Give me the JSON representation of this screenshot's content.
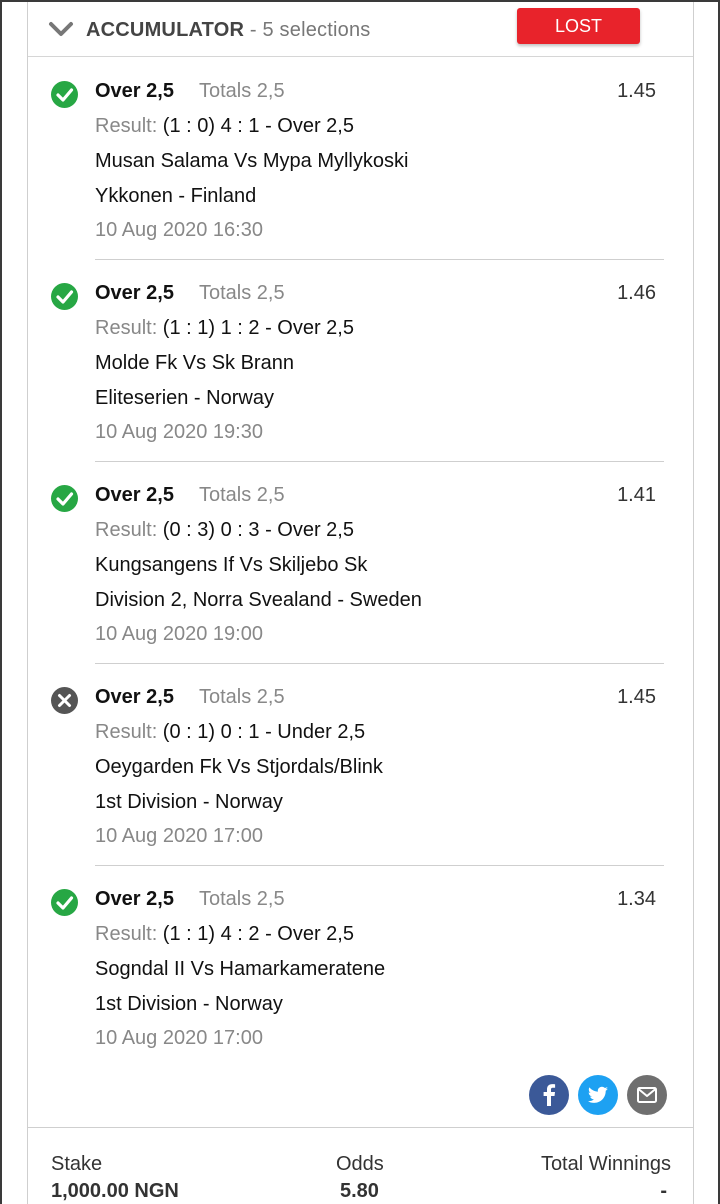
{
  "header": {
    "title": "ACCUMULATOR",
    "subtitle": " - 5 selections",
    "status": "LOST",
    "status_color": "#e8232b"
  },
  "selections": [
    {
      "status": "won",
      "pick": "Over 2,5",
      "market": "Totals 2,5",
      "odds": "1.45",
      "result_label": "Result:",
      "result": " (1 : 0) 4 : 1 - Over 2,5",
      "match": "Musan Salama Vs Mypa Myllykoski",
      "league": "Ykkonen - Finland",
      "date": "10 Aug 2020 16:30"
    },
    {
      "status": "won",
      "pick": "Over 2,5",
      "market": "Totals 2,5",
      "odds": "1.46",
      "result_label": "Result:",
      "result": " (1 : 1) 1 : 2 - Over 2,5",
      "match": "Molde Fk Vs Sk Brann",
      "league": "Eliteserien - Norway",
      "date": "10 Aug 2020 19:30"
    },
    {
      "status": "won",
      "pick": "Over 2,5",
      "market": "Totals 2,5",
      "odds": "1.41",
      "result_label": "Result:",
      "result": " (0 : 3) 0 : 3 - Over 2,5",
      "match": "Kungsangens If Vs Skiljebo Sk",
      "league": "Division 2, Norra Svealand - Sweden",
      "date": "10 Aug 2020 19:00"
    },
    {
      "status": "lost",
      "pick": "Over 2,5",
      "market": "Totals 2,5",
      "odds": "1.45",
      "result_label": "Result:",
      "result": " (0 : 1) 0 : 1 - Under 2,5",
      "match": "Oeygarden Fk Vs Stjordals/Blink",
      "league": "1st Division - Norway",
      "date": "10 Aug 2020 17:00"
    },
    {
      "status": "won",
      "pick": "Over 2,5",
      "market": "Totals 2,5",
      "odds": "1.34",
      "result_label": "Result:",
      "result": " (1 : 1) 4 : 2 - Over 2,5",
      "match": "Sogndal II Vs Hamarkameratene",
      "league": "1st Division - Norway",
      "date": "10 Aug 2020 17:00"
    }
  ],
  "share": [
    {
      "icon": "facebook-icon",
      "color": "#3b5998"
    },
    {
      "icon": "twitter-icon",
      "color": "#1da1f2"
    },
    {
      "icon": "email-icon",
      "color": "#6f6f6f"
    }
  ],
  "footer": {
    "stake_label": "Stake",
    "stake_value": "1,000.00 NGN",
    "odds_label": "Odds",
    "odds_value": "5.80",
    "winnings_label": "Total Winnings",
    "winnings_value": "-"
  },
  "colors": {
    "won": "#27a744",
    "lost": "#555555"
  }
}
